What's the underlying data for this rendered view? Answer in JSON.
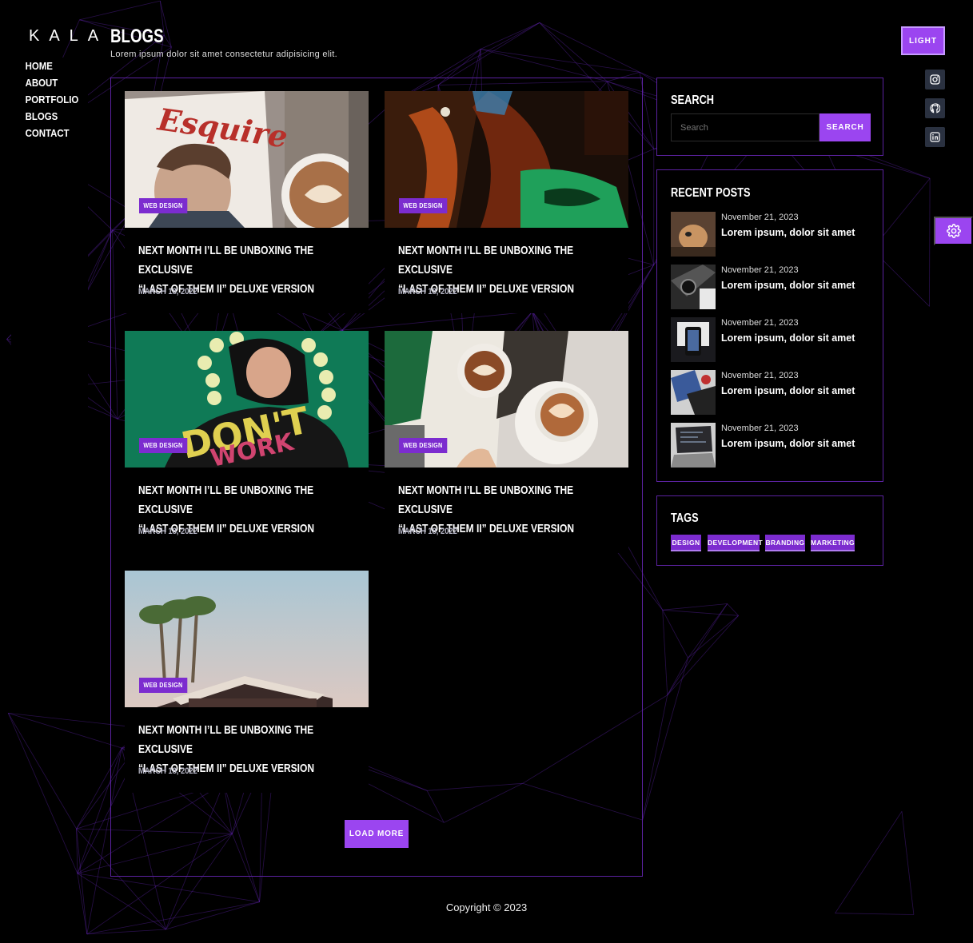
{
  "brand": {
    "logo": "KALA"
  },
  "nav": {
    "items": [
      "HOME",
      "ABOUT",
      "PORTFOLIO",
      "BLOGS",
      "CONTACT"
    ]
  },
  "header": {
    "title": "BLOGS",
    "subtitle": "Lorem ipsum dolor sit amet consectetur adipisicing elit."
  },
  "theme_toggle": {
    "label": "LIGHT"
  },
  "social": [
    "instagram-icon",
    "github-icon",
    "linkedin-icon"
  ],
  "posts": [
    {
      "category": "WEB DESIGN",
      "title_line1": "NEXT MONTH I’LL BE UNBOXING THE EXCLUSIVE",
      "title_line2": "“LAST OF THEM II” DELUXE VERSION",
      "date": "MARCH 18, 2022",
      "image": "magazine-coffee-photo"
    },
    {
      "category": "WEB DESIGN",
      "title_line1": "NEXT MONTH I’LL BE UNBOXING THE EXCLUSIVE",
      "title_line2": "“LAST OF THEM II” DELUXE VERSION",
      "date": "MARCH 18, 2022",
      "image": "neon-portrait-photo"
    },
    {
      "category": "WEB DESIGN",
      "title_line1": "NEXT MONTH I’LL BE UNBOXING THE EXCLUSIVE",
      "title_line2": "“LAST OF THEM II” DELUXE VERSION",
      "date": "MARCH 18, 2022",
      "image": "hoodie-person-photo"
    },
    {
      "category": "WEB DESIGN",
      "title_line1": "NEXT MONTH I’LL BE UNBOXING THE EXCLUSIVE",
      "title_line2": "“LAST OF THEM II” DELUXE VERSION",
      "date": "MARCH 18, 2022",
      "image": "book-latte-photo"
    },
    {
      "category": "WEB DESIGN",
      "title_line1": "NEXT MONTH I’LL BE UNBOXING THE EXCLUSIVE",
      "title_line2": "“LAST OF THEM II” DELUXE VERSION",
      "date": "MARCH 18, 2022",
      "image": "palm-trees-photo"
    }
  ],
  "load_more": {
    "label": "LOAD MORE"
  },
  "search": {
    "title": "SEARCH",
    "placeholder": "Search",
    "button_label": "SEARCH"
  },
  "recent_posts": {
    "title": "RECENT POSTS",
    "items": [
      {
        "date": "November 21, 2023",
        "title": "Lorem ipsum, dolor sit amet",
        "image": "dog-photo"
      },
      {
        "date": "November 21, 2023",
        "title": "Lorem ipsum, dolor sit amet",
        "image": "camera-gear-photo"
      },
      {
        "date": "November 21, 2023",
        "title": "Lorem ipsum, dolor sit amet",
        "image": "laptop-phone-photo"
      },
      {
        "date": "November 21, 2023",
        "title": "Lorem ipsum, dolor sit amet",
        "image": "workspace-photo"
      },
      {
        "date": "November 21, 2023",
        "title": "Lorem ipsum, dolor sit amet",
        "image": "laptop-code-photo"
      }
    ]
  },
  "tags": {
    "title": "TAGS",
    "items": [
      "DESIGN",
      "DEVELOPMENT",
      "BRANDING",
      "MARKETING"
    ]
  },
  "footer": {
    "copyright": "Copyright © 2023"
  },
  "colors": {
    "accent": "#9b45f0",
    "badge": "#7c2ccf",
    "border": "#5b22a0",
    "background": "#000000"
  }
}
